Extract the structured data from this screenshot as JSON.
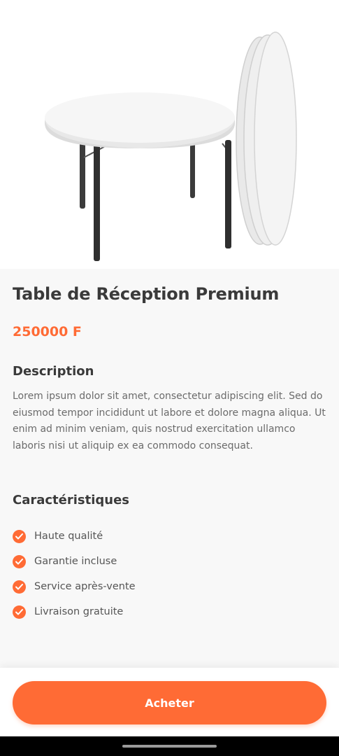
{
  "product": {
    "image_alt": "round folding reception table",
    "title": "Table de Réception Premium",
    "price": "250000 F"
  },
  "description": {
    "heading": "Description",
    "text": "Lorem ipsum dolor sit amet, consectetur adipiscing elit. Sed do eiusmod tempor incididunt ut labore et dolore magna aliqua. Ut enim ad minim veniam, quis nostrud exercitation ullamco laboris nisi ut aliquip ex ea commodo consequat."
  },
  "features": {
    "heading": "Caractéristiques",
    "items": [
      {
        "label": "Haute qualité",
        "icon": "check-circle-icon"
      },
      {
        "label": "Garantie incluse",
        "icon": "check-circle-icon"
      },
      {
        "label": "Service après-vente",
        "icon": "check-circle-icon"
      },
      {
        "label": "Livraison gratuite",
        "icon": "check-circle-icon"
      }
    ]
  },
  "actions": {
    "buy_label": "Acheter"
  },
  "colors": {
    "accent": "#ff6b35",
    "background": "#f8f8f8",
    "text": "#3a3a3a"
  }
}
